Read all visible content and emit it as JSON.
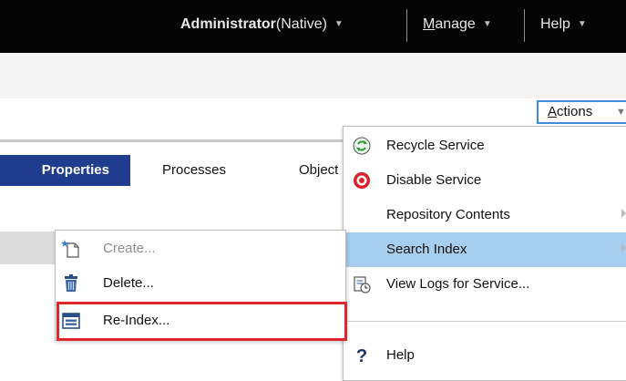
{
  "topbar": {
    "user_bold": "Administrator",
    "user_suffix": "(Native)",
    "manage_underlined": "M",
    "manage_rest": "anage",
    "help": "Help"
  },
  "actions_button": {
    "underlined": "A",
    "rest": "ctions"
  },
  "tabs": [
    {
      "label": "Properties",
      "active": true
    },
    {
      "label": "Processes",
      "active": false
    },
    {
      "label": "Object",
      "active": false
    }
  ],
  "actions_menu": {
    "items": [
      {
        "label": "Recycle Service",
        "icon": "recycle-icon"
      },
      {
        "label": "Disable Service",
        "icon": "disable-icon"
      },
      {
        "label": "Repository Contents",
        "icon": "",
        "submenu": true
      },
      {
        "label": "Search Index",
        "icon": "",
        "submenu": true,
        "highlighted": true
      },
      {
        "label": "View Logs for Service...",
        "icon": "logs-icon"
      },
      {
        "label": "Help",
        "icon": "question-icon"
      }
    ]
  },
  "search_index_submenu": {
    "items": [
      {
        "label": "Create...",
        "icon": "new-document-icon",
        "disabled": true
      },
      {
        "label": "Delete...",
        "icon": "trash-icon",
        "disabled": false
      },
      {
        "label": "Re-Index...",
        "icon": "reindex-icon",
        "disabled": false,
        "annotated": true
      }
    ]
  },
  "colors": {
    "topbar_bg": "#050505",
    "tab_active_bg": "#1f3c8f",
    "menu_highlight": "#a8ceef",
    "annotation_red": "#e0262d",
    "actions_border": "#3a8fd6"
  }
}
